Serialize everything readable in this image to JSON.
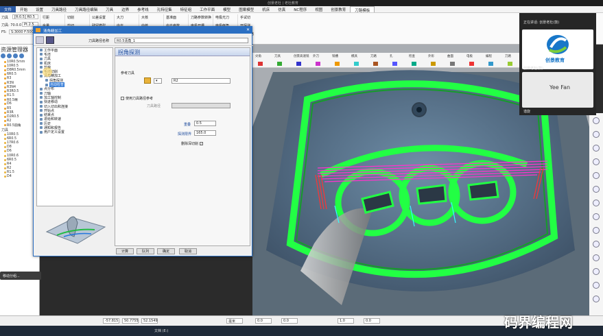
{
  "window": {
    "title": "创景老杜 | 老杜教育",
    "menu": [
      "文件",
      "开始",
      "设置",
      "刀具路径",
      "刀具路径编辑",
      "刀具",
      "边界",
      "参考线",
      "孔特征集",
      "特征组",
      "工作平面",
      "模型",
      "图案模型",
      "机床",
      "仿真",
      "NC程序",
      "视图",
      "创景教育",
      "刀路模板"
    ],
    "active_menu": "文件",
    "selected_menu": "刀路模板"
  },
  "ribbon": {
    "fields": [
      {
        "label": "刀具",
        "value": "[R:0.5] R0.5"
      },
      {
        "label": "刀具: 70.0.0",
        "value": "Pt.2.5"
      },
      {
        "label": "F5:",
        "value": "S:3000 F:5000"
      }
    ],
    "groups": [
      "行距",
      "余量",
      "进给",
      "切削",
      "剪切",
      "偏置方向",
      "公差设置",
      "残留模型",
      "面积清除",
      "大刀",
      "中光",
      "小刀",
      "大核",
      "中核",
      "二核",
      "基准面",
      "中光参数",
      "镜光参数",
      "刀路参数转换",
      "电极开槽",
      "电极中光",
      "电极光刀",
      "电极倒角",
      "面试切",
      "手试切",
      "开探测",
      "辅助刀路"
    ]
  },
  "left_panel": {
    "title": "资源管理器",
    "rows": [
      "10R0.5mm",
      "10R0.5",
      "D8R0.5mm",
      "6R0.5",
      "R3",
      "R3N",
      "R3N4",
      "R3R0.5",
      "R1.5",
      "R0.5精",
      "D6",
      "R5",
      "R3R",
      "D2R0.5",
      "R2",
      "R0.5圆角"
    ],
    "section": "刀具",
    "tools": [
      "10R0.5",
      "6R0.5",
      "17R0.6",
      "D8",
      "D6",
      "10R0.6",
      "6R0.5",
      "R4",
      "R2",
      "R1.5",
      "D4"
    ],
    "floating_tip": "移动分组..."
  },
  "dialog": {
    "title": "清角精加工",
    "path_name_label": "刀具路径名称",
    "path_name_value": "R0.5清角_1",
    "tree": [
      {
        "label": "工作平面",
        "level": 0
      },
      {
        "label": "毛坯",
        "level": 0
      },
      {
        "label": "刀具",
        "level": 0
      },
      {
        "label": "机床",
        "level": 0
      },
      {
        "label": "剪裁",
        "level": 0
      },
      {
        "label": "毛坯切削",
        "level": 0
      },
      {
        "label": "清角精加工",
        "level": 0
      },
      {
        "label": "拐角探测",
        "level": 1
      },
      {
        "label": "自动检查",
        "level": 1,
        "selected": true
      },
      {
        "label": "点分布",
        "level": 0
      },
      {
        "label": "刀轴",
        "level": 0
      },
      {
        "label": "加工轴控制",
        "level": 0
      },
      {
        "label": "快进移动",
        "level": 0
      },
      {
        "label": "切入切出和连接",
        "level": 0
      },
      {
        "label": "开始点",
        "level": 0
      },
      {
        "label": "结束点",
        "level": 0
      },
      {
        "label": "进给和转速",
        "level": 0
      },
      {
        "label": "历史",
        "level": 0
      },
      {
        "label": "通知和报告",
        "level": 0
      },
      {
        "label": "用户定义设置",
        "level": 0
      }
    ],
    "panel_title": "拐角探测",
    "ref_tool_label": "参考刀具",
    "ref_tool_value": "R2",
    "use_ref_path_label": "使用刀具路径参考",
    "ref_path_sub_label": "刀具路径",
    "overlap_label": "重叠",
    "overlap_value": "0.5",
    "angle_label": "探测限界",
    "angle_value": "165.0",
    "remove_label": "删除深切削",
    "buttons": [
      "计算",
      "队列",
      "确定",
      "取消"
    ]
  },
  "viewport_toolbar": [
    "尖角",
    "刀具",
    "创景高速铣",
    "外刀",
    "铣槽",
    "模具",
    "刀路",
    "孔",
    "检查",
    "外形",
    "曲面",
    "电极",
    "编程",
    "刀路",
    "电极",
    "编辑",
    "图像"
  ],
  "call": {
    "speaking": "正在讲话: 创景老杜(鼓)",
    "logo_text": "创景教育",
    "name1": "创景老杜(鼓)",
    "tile2_text": "Yee Fan",
    "name2": "谐旋"
  },
  "status": {
    "x": "-57.815",
    "y": "50.7755",
    "z": "52.1549",
    "unit": "毫米",
    "v1": "0.0",
    "v2": "0.0",
    "v3": "1.0",
    "v4": "0.0",
    "file": "文档 (E:)"
  },
  "watermark": "码界编程网"
}
